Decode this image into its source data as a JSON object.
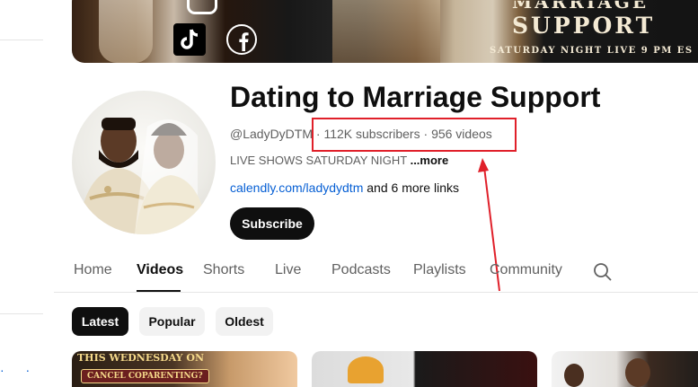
{
  "banner": {
    "title_top": "MARRIAGE",
    "title": "SUPPORT",
    "subtitle": "SATURDAY NIGHT LIVE 9 PM ES"
  },
  "channel": {
    "name": "Dating to Marriage Support",
    "handle": "@LadyDyDTM",
    "separator": " · ",
    "subscribers": "112K subscribers",
    "videos": "956 videos",
    "description": "LIVE SHOWS SATURDAY NIGHT ",
    "more_label": "...more",
    "link_url": "calendly.com/ladydydtm",
    "link_more": " and 6 more links",
    "subscribe_label": "Subscribe"
  },
  "tabs": [
    "Home",
    "Videos",
    "Shorts",
    "Live",
    "Podcasts",
    "Playlists",
    "Community"
  ],
  "active_tab": "Videos",
  "chips": [
    "Latest",
    "Popular",
    "Oldest"
  ],
  "active_chip": "Latest",
  "thumbnails": [
    {
      "text_top": "THIS WEDNESDAY ON",
      "text_bottom": "CANCEL COPARENTING?"
    },
    {
      "text_top": "",
      "text_bottom": ""
    },
    {
      "text_top": "",
      "text_bottom": ""
    }
  ],
  "colors": {
    "accent_link": "#065fd4",
    "annotation_red": "#e0202a",
    "subscribe_bg": "#0f0f0f"
  },
  "icons": {
    "search": "search-icon",
    "tiktok": "tiktok-icon",
    "facebook": "facebook-icon",
    "instagram": "instagram-icon"
  }
}
